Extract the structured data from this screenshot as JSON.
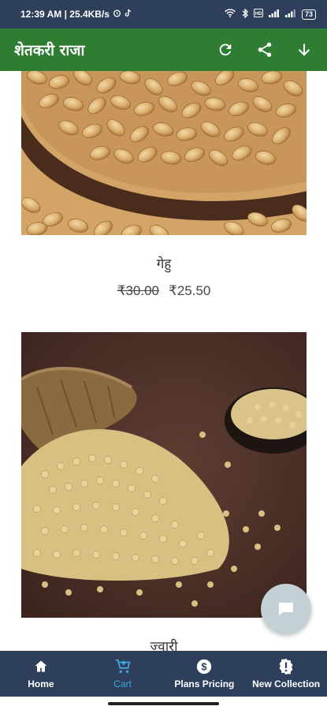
{
  "status_bar": {
    "time_info": "12:39 AM | 25.4KB/s",
    "battery": "73"
  },
  "app_bar": {
    "title": "शेतकरी राजा",
    "actions": [
      "refresh-icon",
      "share-icon",
      "download-icon"
    ]
  },
  "products": [
    {
      "name": "गेहु",
      "old_price": "₹30.00",
      "price": "₹25.50"
    },
    {
      "name": "ज्वारी",
      "old_price": "",
      "price": ""
    }
  ],
  "bottom_nav": {
    "items": [
      {
        "label": "Home",
        "icon": "home-icon"
      },
      {
        "label": "Cart",
        "icon": "cart-icon"
      },
      {
        "label": "Plans Pricing",
        "icon": "dollar-icon"
      },
      {
        "label": "New Collection",
        "icon": "new-collection-icon"
      }
    ],
    "active_index": 1
  },
  "colors": {
    "status_bar": "#2e3f5c",
    "app_bar": "#2e7d32",
    "bottom_nav": "#2e3f5c",
    "active_tab": "#3ea6dc",
    "chat_fab": "#c3d0d6"
  }
}
